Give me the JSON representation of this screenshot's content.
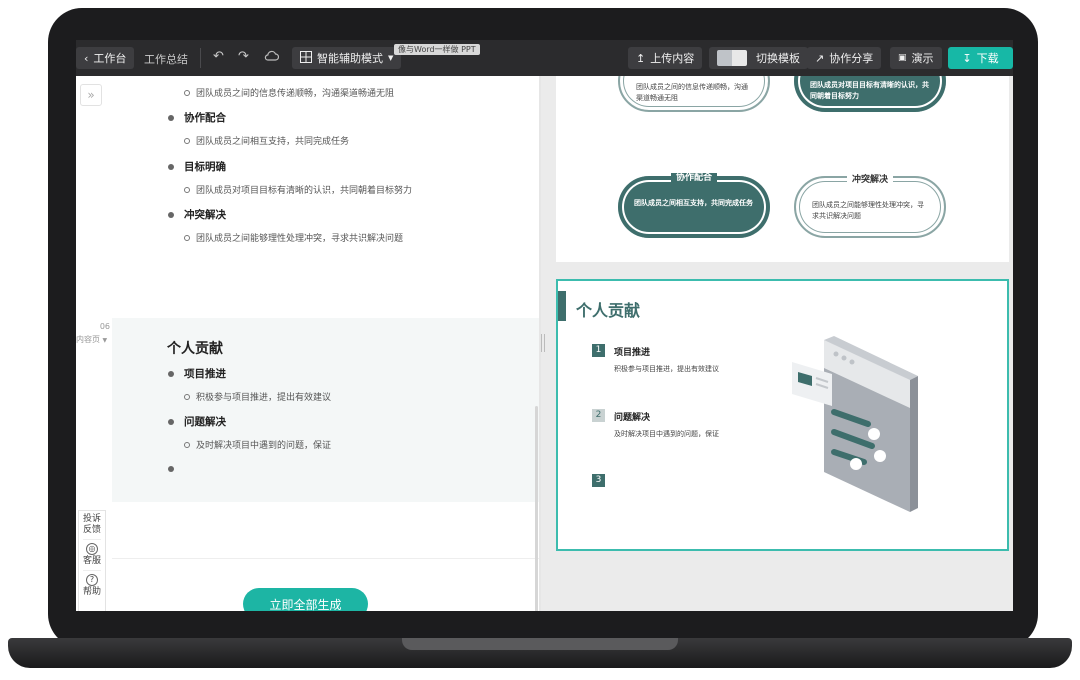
{
  "toolbar": {
    "back_label": "工作台",
    "doc_title": "工作总结",
    "mode_label": "智能辅助模式",
    "tooltip": "像与Word一样做 PPT",
    "upload_label": "上传内容",
    "switch_template_label": "切换模板",
    "share_label": "协作分享",
    "present_label": "演示",
    "download_label": "下载"
  },
  "editor": {
    "sub_top": "团队成员之间的信息传递顺畅，沟通渠道畅通无阻",
    "items": [
      {
        "title": "协作配合",
        "sub": "团队成员之间相互支持，共同完成任务"
      },
      {
        "title": "目标明确",
        "sub": "团队成员对项目目标有清晰的认识，共同朝着目标努力"
      },
      {
        "title": "冲突解决",
        "sub": "团队成员之间能够理性处理冲突，寻求共识解决问题"
      }
    ],
    "slide_number": "06",
    "slide_type": "内容页",
    "section_title": "个人贡献",
    "section_items": [
      {
        "title": "项目推进",
        "sub": "积极参与项目推进，提出有效建议"
      },
      {
        "title": "问题解决",
        "sub": "及时解决项目中遇到的问题，保证"
      }
    ],
    "generate_label": "立即全部生成"
  },
  "side_tools": {
    "complaint": "投诉",
    "feedback": "反馈",
    "service": "客服",
    "help": "帮助"
  },
  "preview": {
    "pills": [
      {
        "text": "团队成员之间的信息传递顺畅，沟通渠道畅通无阻",
        "style": "outline"
      },
      {
        "text": "团队成员对项目目标有清晰的认识，共同朝着目标努力",
        "style": "filled"
      },
      {
        "title": "协作配合",
        "text": "团队成员之间相互支持，共同完成任务",
        "style": "filled"
      },
      {
        "title": "冲突解决",
        "text": "团队成员之间能够理性处理冲突，寻求共识解决问题",
        "style": "outline"
      }
    ],
    "slide_title": "个人贡献",
    "items": [
      {
        "num": "1",
        "title": "项目推进",
        "desc": "积极参与项目推进，提出有效建议"
      },
      {
        "num": "2",
        "title": "问题解决",
        "desc": "及时解决项目中遇到的问题，保证"
      },
      {
        "num": "3"
      }
    ]
  },
  "colors": {
    "accent_teal": "#1db5a4",
    "slide_dark": "#3e6e6c",
    "toolbar_bg": "#2b2b2d"
  }
}
